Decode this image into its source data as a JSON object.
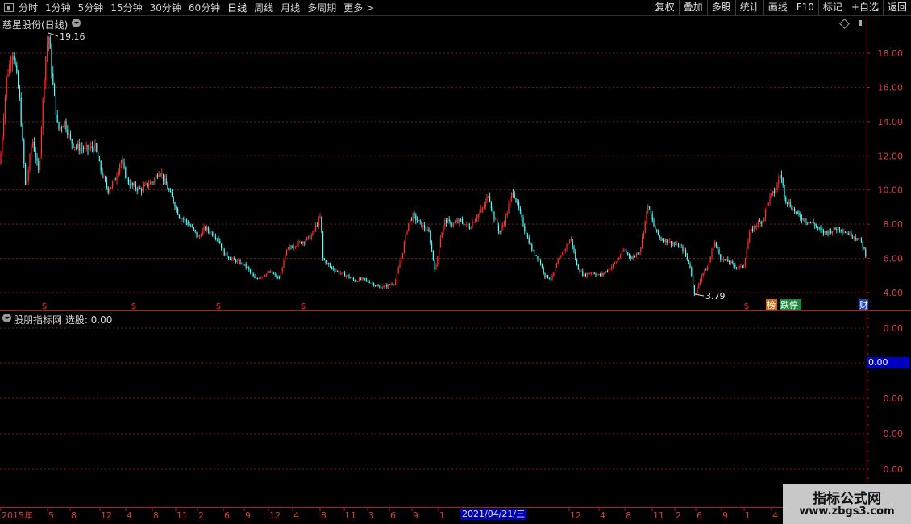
{
  "toolbar": {
    "periods": [
      "分时",
      "1分钟",
      "5分钟",
      "15分钟",
      "30分钟",
      "60分钟",
      "日线",
      "周线",
      "月线",
      "多周期",
      "更多 >"
    ],
    "active_period": "日线",
    "right_buttons": [
      "复权",
      "叠加",
      "多股",
      "统计",
      "画线",
      "F10",
      "标记",
      "+自选",
      "返回"
    ]
  },
  "main": {
    "title": "慈星股份(日线)",
    "high_label": "19.16",
    "low_label": "3.79",
    "badges": {
      "bang": "榜",
      "dieting": "跌停",
      "cai": "财"
    },
    "special_marker": "$"
  },
  "indicator": {
    "title": "股朋指标网 选股: 0.00",
    "current_value": "0.00"
  },
  "date_highlight": "2021/04/21/三",
  "watermark": {
    "title": "指标公式网",
    "url": "www.zbgs3.com"
  },
  "chart_data": {
    "type": "candlestick",
    "title": "慈星股份(日线)",
    "price_axis_ticks": [
      4.0,
      6.0,
      8.0,
      10.0,
      12.0,
      14.0,
      16.0,
      18.0
    ],
    "indicator_axis_ticks": [
      "0.00",
      "0.00",
      "0.00",
      "0.00"
    ],
    "ylim": [
      3.1,
      19.7
    ],
    "x_tick_labels": [
      "2015年",
      "5",
      "8",
      "12",
      "4",
      "8",
      "11",
      "2",
      "6",
      "9",
      "12",
      "4",
      "8",
      "11",
      "3",
      "6",
      "9",
      "1",
      "4",
      "8",
      "12",
      "4",
      "8",
      "11",
      "2",
      "6",
      "9",
      "1",
      "4"
    ],
    "price_path": [
      [
        0,
        11.5
      ],
      [
        8,
        16.5
      ],
      [
        16,
        18.2
      ],
      [
        24,
        15.5
      ],
      [
        32,
        10.0
      ],
      [
        40,
        13.0
      ],
      [
        48,
        11.0
      ],
      [
        56,
        17.5
      ],
      [
        60,
        19.16
      ],
      [
        66,
        16.0
      ],
      [
        72,
        13.5
      ],
      [
        80,
        14.0
      ],
      [
        88,
        12.8
      ],
      [
        96,
        12.5
      ],
      [
        108,
        12.4
      ],
      [
        118,
        12.5
      ],
      [
        126,
        11.0
      ],
      [
        134,
        10.0
      ],
      [
        142,
        10.5
      ],
      [
        150,
        11.8
      ],
      [
        158,
        10.5
      ],
      [
        166,
        10.2
      ],
      [
        174,
        10.0
      ],
      [
        182,
        10.3
      ],
      [
        190,
        10.5
      ],
      [
        198,
        11.2
      ],
      [
        206,
        10.3
      ],
      [
        214,
        9.5
      ],
      [
        222,
        8.5
      ],
      [
        230,
        8.2
      ],
      [
        238,
        7.8
      ],
      [
        246,
        7.2
      ],
      [
        254,
        7.8
      ],
      [
        262,
        7.5
      ],
      [
        270,
        7.2
      ],
      [
        278,
        6.3
      ],
      [
        286,
        6.0
      ],
      [
        296,
        5.8
      ],
      [
        306,
        5.5
      ],
      [
        316,
        4.8
      ],
      [
        326,
        5.0
      ],
      [
        336,
        5.2
      ],
      [
        346,
        4.8
      ],
      [
        356,
        6.5
      ],
      [
        366,
        6.8
      ],
      [
        376,
        7.0
      ],
      [
        386,
        7.3
      ],
      [
        398,
        8.5
      ],
      [
        400,
        6.0
      ],
      [
        410,
        5.5
      ],
      [
        420,
        5.2
      ],
      [
        430,
        5.0
      ],
      [
        440,
        4.7
      ],
      [
        450,
        4.8
      ],
      [
        460,
        4.6
      ],
      [
        470,
        4.3
      ],
      [
        480,
        4.4
      ],
      [
        490,
        4.6
      ],
      [
        500,
        6.5
      ],
      [
        506,
        8.0
      ],
      [
        512,
        8.5
      ],
      [
        522,
        8.0
      ],
      [
        532,
        7.5
      ],
      [
        540,
        5.2
      ],
      [
        546,
        7.2
      ],
      [
        552,
        8.2
      ],
      [
        562,
        8.0
      ],
      [
        572,
        8.2
      ],
      [
        582,
        7.8
      ],
      [
        592,
        8.5
      ],
      [
        600,
        9.0
      ],
      [
        606,
        9.8
      ],
      [
        612,
        8.5
      ],
      [
        620,
        7.5
      ],
      [
        628,
        8.5
      ],
      [
        636,
        10.0
      ],
      [
        644,
        8.8
      ],
      [
        652,
        7.5
      ],
      [
        660,
        6.5
      ],
      [
        668,
        6.0
      ],
      [
        676,
        5.0
      ],
      [
        684,
        4.8
      ],
      [
        692,
        5.8
      ],
      [
        700,
        6.5
      ],
      [
        708,
        7.2
      ],
      [
        716,
        5.5
      ],
      [
        724,
        5.0
      ],
      [
        734,
        5.2
      ],
      [
        744,
        5.0
      ],
      [
        754,
        5.3
      ],
      [
        764,
        5.8
      ],
      [
        774,
        6.5
      ],
      [
        784,
        6.0
      ],
      [
        794,
        6.5
      ],
      [
        804,
        9.2
      ],
      [
        810,
        8.0
      ],
      [
        818,
        7.2
      ],
      [
        828,
        7.0
      ],
      [
        838,
        6.8
      ],
      [
        848,
        6.5
      ],
      [
        856,
        5.5
      ],
      [
        862,
        3.79
      ],
      [
        870,
        5.0
      ],
      [
        878,
        5.5
      ],
      [
        886,
        7.0
      ],
      [
        894,
        6.0
      ],
      [
        904,
        5.8
      ],
      [
        914,
        5.5
      ],
      [
        922,
        5.5
      ],
      [
        930,
        7.5
      ],
      [
        938,
        8.0
      ],
      [
        946,
        8.2
      ],
      [
        954,
        9.5
      ],
      [
        962,
        10.0
      ],
      [
        968,
        11.0
      ],
      [
        974,
        9.5
      ],
      [
        982,
        9.0
      ],
      [
        990,
        8.5
      ],
      [
        1000,
        8.2
      ],
      [
        1010,
        8.0
      ],
      [
        1020,
        7.5
      ],
      [
        1030,
        7.6
      ],
      [
        1040,
        7.8
      ],
      [
        1050,
        7.5
      ],
      [
        1060,
        7.3
      ],
      [
        1068,
        7.0
      ],
      [
        1074,
        6.2
      ]
    ]
  }
}
